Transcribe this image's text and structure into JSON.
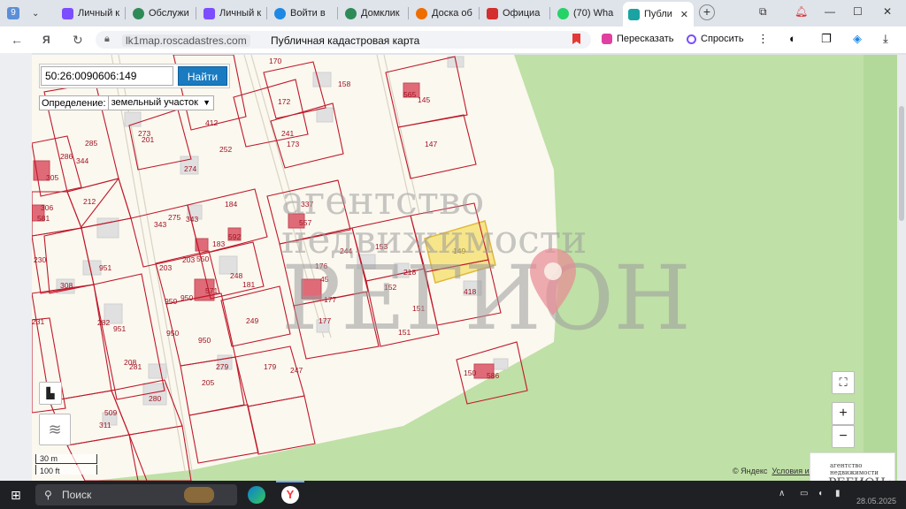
{
  "tabs": [
    {
      "label": "9",
      "color": "#5b8fd6"
    },
    {
      "label": "Личный к",
      "color": "#7c4dff"
    },
    {
      "label": "Обслужи",
      "color": "#2e8b57"
    },
    {
      "label": "Личный к",
      "color": "#7c4dff"
    },
    {
      "label": "Войти в",
      "color": "#1e88e5"
    },
    {
      "label": "Домклик",
      "color": "#2e8b57"
    },
    {
      "label": "Доска об",
      "color": "#ef6c00"
    },
    {
      "label": "Официа",
      "color": "#d32f2f"
    },
    {
      "label": "(70) Wha",
      "color": "#25d366"
    },
    {
      "label": "Публи",
      "color": "#1aa3a3",
      "active": true
    }
  ],
  "address": {
    "host": "lk1map.roscadastres.com",
    "page_title": "Публичная кадастровая карта",
    "retell_label": "Пересказать",
    "ask_label": "Спросить"
  },
  "search": {
    "value": "50:26:0090606:149",
    "button_label": "Найти",
    "definition_label": "Определение:",
    "definition_value": "земельный участок"
  },
  "map": {
    "parcels": [
      {
        "label": "170"
      },
      {
        "label": "158"
      },
      {
        "label": "565"
      },
      {
        "label": "145"
      },
      {
        "label": "172"
      },
      {
        "label": "412"
      },
      {
        "label": "241"
      },
      {
        "label": "273"
      },
      {
        "label": "201"
      },
      {
        "label": "173"
      },
      {
        "label": "147"
      },
      {
        "label": "286"
      },
      {
        "label": "285"
      },
      {
        "label": "344"
      },
      {
        "label": "252"
      },
      {
        "label": "274"
      },
      {
        "label": "305"
      },
      {
        "label": "212"
      },
      {
        "label": "337"
      },
      {
        "label": "306"
      },
      {
        "label": "581"
      },
      {
        "label": "275"
      },
      {
        "label": "343"
      },
      {
        "label": "184"
      },
      {
        "label": "343"
      },
      {
        "label": "557"
      },
      {
        "label": "183"
      },
      {
        "label": "592"
      },
      {
        "label": "153"
      },
      {
        "label": "244"
      },
      {
        "label": "149"
      },
      {
        "label": "230"
      },
      {
        "label": "951"
      },
      {
        "label": "203"
      },
      {
        "label": "550"
      },
      {
        "label": "203"
      },
      {
        "label": "176"
      },
      {
        "label": "218"
      },
      {
        "label": "308"
      },
      {
        "label": "248"
      },
      {
        "label": "181"
      },
      {
        "label": "45"
      },
      {
        "label": "152"
      },
      {
        "label": "418"
      },
      {
        "label": "950"
      },
      {
        "label": "950"
      },
      {
        "label": "571"
      },
      {
        "label": "177"
      },
      {
        "label": "151"
      },
      {
        "label": "231"
      },
      {
        "label": "282"
      },
      {
        "label": "951"
      },
      {
        "label": "950"
      },
      {
        "label": "249"
      },
      {
        "label": "177"
      },
      {
        "label": "151"
      },
      {
        "label": "950"
      },
      {
        "label": "208"
      },
      {
        "label": "281"
      },
      {
        "label": "279"
      },
      {
        "label": "179"
      },
      {
        "label": "247"
      },
      {
        "label": "150"
      },
      {
        "label": "586"
      },
      {
        "label": "205"
      },
      {
        "label": "280"
      },
      {
        "label": "509"
      },
      {
        "label": "311"
      }
    ],
    "highlight_parcel": "149",
    "scale_m": "30 m",
    "scale_ft": "100 ft",
    "attribution": "© Яндекс",
    "terms": "Условия ис"
  },
  "watermark": {
    "line1": "агентство",
    "line2": "недвижимости",
    "line3": "РЕГИОН"
  },
  "logo": {
    "line1": "агентство",
    "line2": "недвижимости",
    "line3": "РЕГИОН"
  },
  "taskbar": {
    "search_label": "Поиск",
    "date": "28.05.2025"
  }
}
